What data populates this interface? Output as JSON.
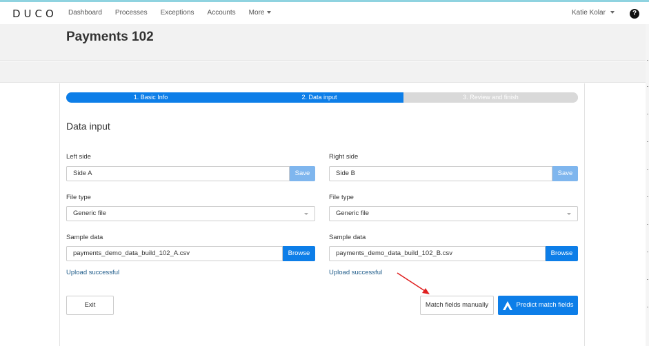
{
  "brand": {
    "logo_text": "DUCO",
    "topline_color": "#8fd3e0"
  },
  "nav": {
    "items": [
      {
        "label": "Dashboard"
      },
      {
        "label": "Processes"
      },
      {
        "label": "Exceptions"
      },
      {
        "label": "Accounts"
      }
    ],
    "more_label": "More",
    "user_label": "Katie Kolar",
    "help_label": "?"
  },
  "page": {
    "title": "Payments 102"
  },
  "progress": {
    "steps": [
      {
        "label": "1. Basic Info",
        "state": "complete"
      },
      {
        "label": "2. Data input",
        "state": "current"
      },
      {
        "label": "3. Review and finish",
        "state": "todo"
      }
    ],
    "active_color": "#0d7ee8"
  },
  "form": {
    "section_title": "Data input",
    "left": {
      "side_label": "Left side",
      "side_value": "Side A",
      "save_label": "Save",
      "file_type_label": "File type",
      "file_type_value": "Generic file",
      "sample_label": "Sample data",
      "sample_value": "payments_demo_data_build_102_A.csv",
      "browse_label": "Browse",
      "status": "Upload successful"
    },
    "right": {
      "side_label": "Right side",
      "side_value": "Side B",
      "save_label": "Save",
      "file_type_label": "File type",
      "file_type_value": "Generic file",
      "sample_label": "Sample data",
      "sample_value": "payments_demo_data_build_102_B.csv",
      "browse_label": "Browse",
      "status": "Upload successful"
    }
  },
  "actions": {
    "exit_label": "Exit",
    "match_manual_label": "Match fields manually",
    "predict_label": "Predict match fields",
    "predict_icon": "duco-ai-icon",
    "annotation_arrow_color": "#e02020"
  }
}
